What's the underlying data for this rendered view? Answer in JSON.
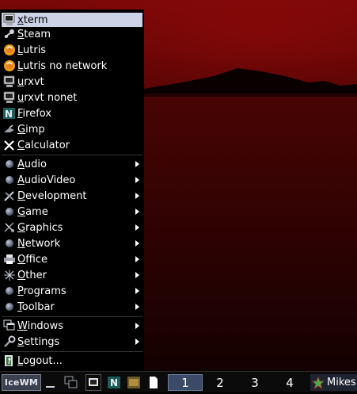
{
  "menu": {
    "apps": [
      {
        "label": "xterm",
        "icon": "terminal-icon"
      },
      {
        "label": "Steam",
        "icon": "steam-icon"
      },
      {
        "label": "Lutris",
        "icon": "lutris-icon"
      },
      {
        "label": "Lutris no network",
        "icon": "lutris-icon"
      },
      {
        "label": "urxvt",
        "icon": "terminal-icon"
      },
      {
        "label": "urxvt nonet",
        "icon": "terminal-icon"
      },
      {
        "label": "Firefox",
        "icon": "netscape-icon"
      },
      {
        "label": "Gimp",
        "icon": "gimp-icon"
      },
      {
        "label": "Calculator",
        "icon": "calculator-icon"
      }
    ],
    "categories": [
      {
        "label": "Audio",
        "icon": "folder-ball-icon"
      },
      {
        "label": "AudioVideo",
        "icon": "folder-ball-icon"
      },
      {
        "label": "Development",
        "icon": "development-icon"
      },
      {
        "label": "Game",
        "icon": "folder-ball-icon"
      },
      {
        "label": "Graphics",
        "icon": "graphics-icon"
      },
      {
        "label": "Network",
        "icon": "folder-ball-icon"
      },
      {
        "label": "Office",
        "icon": "printer-icon"
      },
      {
        "label": "Other",
        "icon": "other-icon"
      },
      {
        "label": "Programs",
        "icon": "folder-ball-icon"
      },
      {
        "label": "Toolbar",
        "icon": "folder-ball-icon"
      }
    ],
    "system": [
      {
        "label": "Windows",
        "icon": "windows-icon"
      },
      {
        "label": "Settings",
        "icon": "settings-icon"
      }
    ],
    "logout": {
      "label": "Logout...",
      "icon": "logout-icon"
    }
  },
  "taskbar": {
    "start_label": "IceWM",
    "workspaces": [
      "1",
      "2",
      "3",
      "4"
    ],
    "active_workspace": "1",
    "window_button_label": "Mikes"
  },
  "colors": {
    "selection": "#ccd3e6",
    "menu_bg": "#000000",
    "desktop": "#5c0505"
  }
}
